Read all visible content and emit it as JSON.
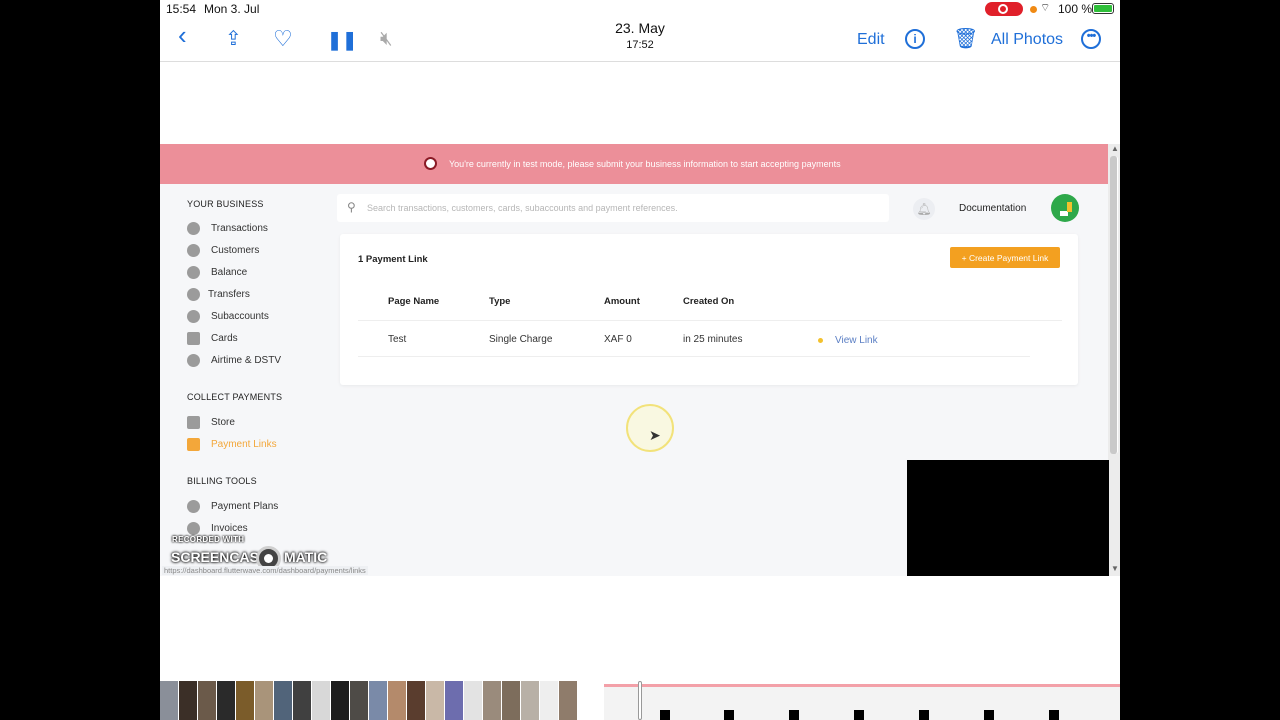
{
  "status_bar": {
    "time": "15:54",
    "date": "Mon 3. Jul",
    "battery": "100 %",
    "colors": {
      "record": "#e0202a",
      "battery": "#2fbf3a"
    }
  },
  "photos_toolbar": {
    "date": "23. May",
    "time": "17:52",
    "edit": "Edit",
    "all_photos": "All Photos",
    "info_glyph": "i",
    "more_glyph": "•••",
    "icons": [
      "chevron-left-icon",
      "share-icon",
      "heart-icon",
      "pause-icon",
      "speaker-muted-icon",
      "info-icon",
      "trash-icon",
      "more-icon"
    ],
    "accent": "#1f6fd8"
  },
  "dashboard": {
    "banner": "You're currently in test mode, please submit your business information to start accepting payments",
    "banner_color": "#ec8f99",
    "search_placeholder": "Search transactions, customers, cards, subaccounts and payment references.",
    "documentation": "Documentation",
    "sidebar": {
      "your_business_title": "YOUR BUSINESS",
      "your_business": [
        {
          "label": "Transactions",
          "icon": "transactions-icon"
        },
        {
          "label": "Customers",
          "icon": "customers-icon"
        },
        {
          "label": "Balance",
          "icon": "balance-icon"
        },
        {
          "label": "Transfers",
          "icon": "transfers-icon"
        },
        {
          "label": "Subaccounts",
          "icon": "subaccounts-icon"
        },
        {
          "label": "Cards",
          "icon": "card-icon"
        },
        {
          "label": "Airtime & DSTV",
          "icon": "airtime-icon"
        }
      ],
      "collect_payments_title": "COLLECT PAYMENTS",
      "collect_payments": [
        {
          "label": "Store",
          "icon": "store-icon"
        },
        {
          "label": "Payment Links",
          "icon": "payment-link-icon",
          "active": true
        }
      ],
      "billing_tools_title": "BILLING TOOLS",
      "billing_tools": [
        {
          "label": "Payment Plans",
          "icon": "payment-plans-icon"
        },
        {
          "label": "Invoices",
          "icon": "invoices-icon"
        }
      ],
      "active_color": "#f3a73a"
    },
    "payment_links": {
      "count_label": "1 Payment Link",
      "create_button": "+ Create Payment Link",
      "button_color": "#f3a020",
      "columns": [
        "Page Name",
        "Type",
        "Amount",
        "Created On"
      ],
      "rows": [
        {
          "page_name": "Test",
          "type": "Single Charge",
          "amount": "XAF 0",
          "created_on": "in 25 minutes",
          "action": "View Link"
        }
      ]
    },
    "status_url": "https://dashboard.flutterwave.com/dashboard/payments/links"
  },
  "watermark": {
    "line1": "RECORDED WITH",
    "line2a": "SCREENCAST",
    "line2b": "MATIC"
  }
}
